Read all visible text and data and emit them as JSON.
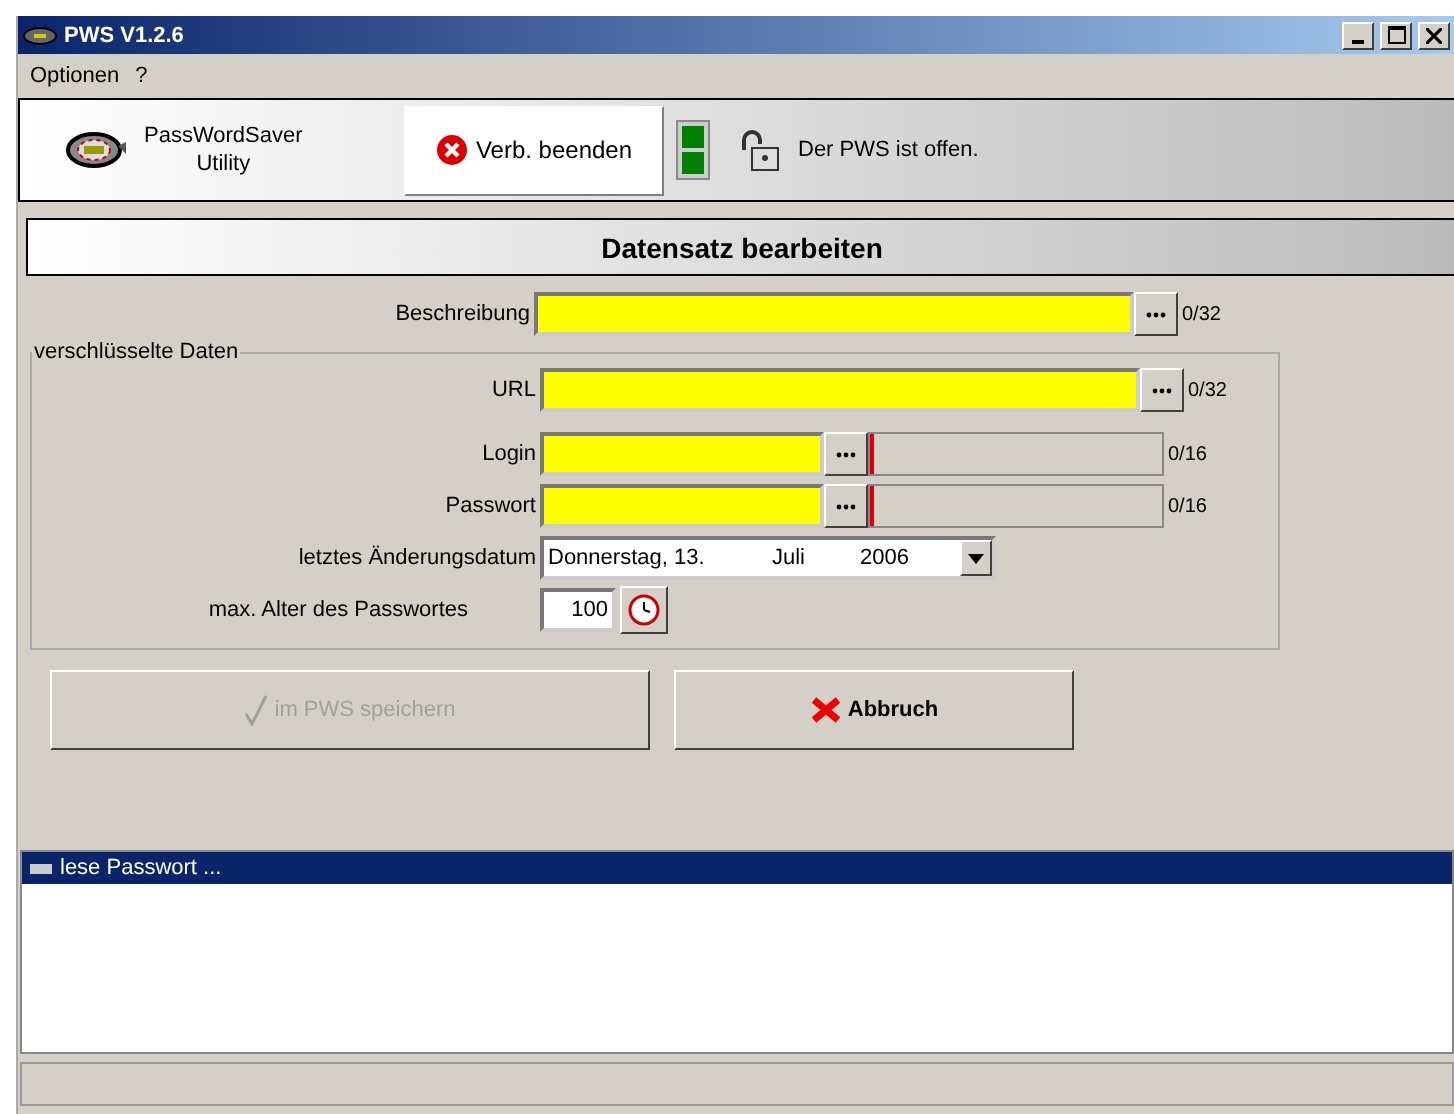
{
  "window": {
    "title": "PWS V1.2.6"
  },
  "menu": [
    "Optionen",
    "?"
  ],
  "toolbar": {
    "app_name": "PassWordSaver",
    "app_subtitle": "Utility",
    "disconnect_button": "Verb. beenden",
    "lights": [
      {
        "on": true
      },
      {
        "on": true
      }
    ],
    "status": "Der PWS ist offen."
  },
  "heading": "Datensatz bearbeiten",
  "description": {
    "label": "Beschreibung",
    "counter": "0/32"
  },
  "group": {
    "title": "verschlüsselte Daten",
    "url": {
      "label": "URL",
      "counter": "0/32"
    },
    "secrets": [
      {
        "label": "Login",
        "level": 0,
        "counter": "0/16"
      },
      {
        "label": "Passwort",
        "level": 0,
        "counter": "0/16"
      }
    ],
    "date": {
      "label": "letztes Änderungsdatum",
      "weekday_day": "Donnerstag, 13.",
      "month": "Juli",
      "year": "2006"
    },
    "max_age": {
      "label": "max. Alter des Passwortes",
      "value": "100"
    }
  },
  "buttons": [
    {
      "label": "im PWS speichern",
      "kind": "save",
      "disabled": true
    },
    {
      "label": "Abbruch",
      "kind": "cancel",
      "disabled": false
    }
  ],
  "log": [
    {
      "text": "lese Passwort ...",
      "selected": true
    }
  ]
}
